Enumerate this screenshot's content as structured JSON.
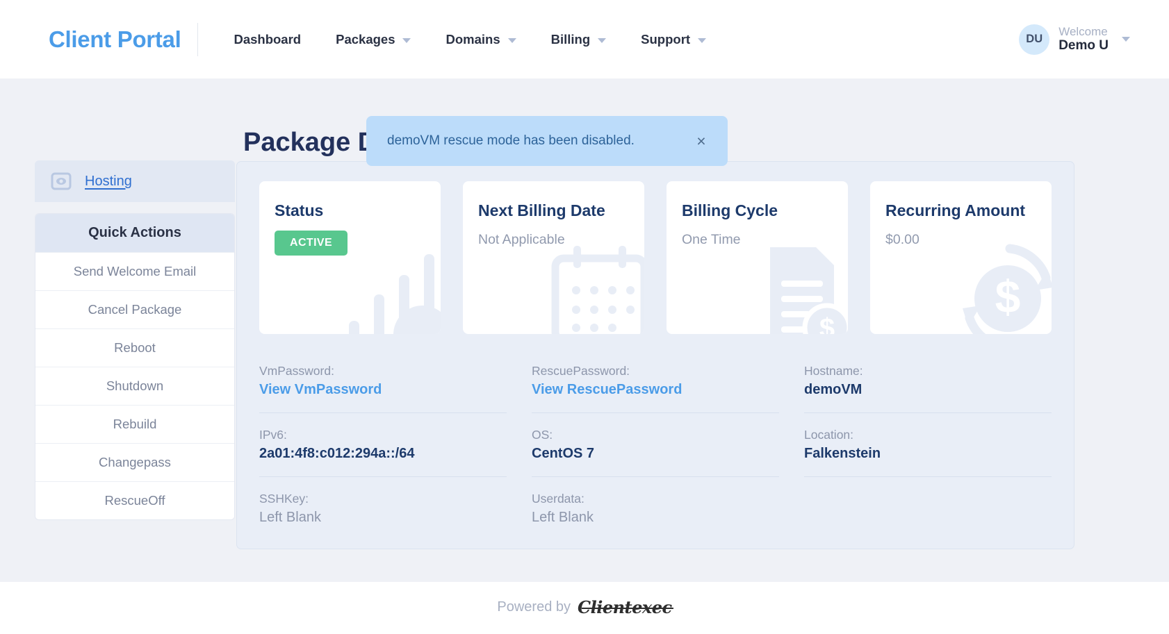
{
  "header": {
    "brand": "Client Portal",
    "nav": [
      {
        "label": "Dashboard",
        "has_caret": false
      },
      {
        "label": "Packages",
        "has_caret": true
      },
      {
        "label": "Domains",
        "has_caret": true
      },
      {
        "label": "Billing",
        "has_caret": true
      },
      {
        "label": "Support",
        "has_caret": true
      }
    ],
    "user": {
      "initials": "DU",
      "welcome_label": "Welcome",
      "name": "Demo U"
    }
  },
  "toast": {
    "message": "demoVM rescue mode has been disabled.",
    "close_label": "×",
    "bg_color": "#bcdcfa",
    "text_color": "#2d6399"
  },
  "page": {
    "title": "Package Details"
  },
  "sidebar": {
    "hosting_label": "Hosting",
    "quick_actions_title": "Quick Actions",
    "quick_actions": [
      "Send Welcome Email",
      "Cancel Package",
      "Reboot",
      "Shutdown",
      "Rebuild",
      "Changepass",
      "RescueOff"
    ]
  },
  "cards": [
    {
      "title": "Status",
      "badge": "ACTIVE",
      "value": "",
      "art": "bars",
      "badge_color": "#58c78e"
    },
    {
      "title": "Next Billing Date",
      "badge": "",
      "value": "Not Applicable",
      "art": "calendar"
    },
    {
      "title": "Billing Cycle",
      "badge": "",
      "value": "One Time",
      "art": "invoice"
    },
    {
      "title": "Recurring Amount",
      "badge": "",
      "value": "$0.00",
      "art": "recurring"
    }
  ],
  "details": [
    {
      "label": "VmPassword:",
      "value": "View VmPassword",
      "style": "link",
      "ruled": true
    },
    {
      "label": "RescuePassword:",
      "value": "View RescuePassword",
      "style": "link",
      "ruled": true
    },
    {
      "label": "Hostname:",
      "value": "demoVM",
      "style": "strong",
      "ruled": true
    },
    {
      "label": "IPv6:",
      "value": "2a01:4f8:c012:294a::/64",
      "style": "strong",
      "ruled": true
    },
    {
      "label": "OS:",
      "value": "CentOS 7",
      "style": "strong",
      "ruled": true
    },
    {
      "label": "Location:",
      "value": "Falkenstein",
      "style": "strong",
      "ruled": true
    },
    {
      "label": "SSHKey:",
      "value": "Left Blank",
      "style": "muted",
      "ruled": false
    },
    {
      "label": "Userdata:",
      "value": "Left Blank",
      "style": "muted",
      "ruled": false
    },
    {
      "label": "",
      "value": "",
      "style": "blank",
      "ruled": false
    }
  ],
  "footer": {
    "powered_by": "Powered by",
    "logo_text": "Clientexec"
  }
}
